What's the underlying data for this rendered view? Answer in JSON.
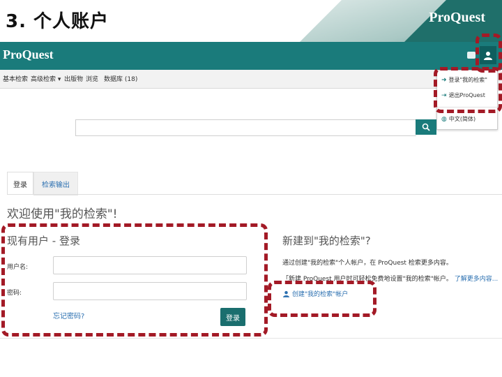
{
  "slide": {
    "title": "3. 个人账户",
    "deco_logo": "ProQuest"
  },
  "header": {
    "brand": "ProQuest",
    "icons": [
      "folder-icon",
      "user-icon"
    ]
  },
  "nav": {
    "items": [
      "基本检索",
      "高级检索 ▾",
      "出版物",
      "浏览",
      "数据库 (18)"
    ]
  },
  "account_menu": {
    "items": [
      {
        "icon": "login-icon",
        "label": "登录\"我的检索\""
      },
      {
        "icon": "logout-icon",
        "label": "退出ProQuest"
      },
      {
        "icon": "globe-icon",
        "label": "中文(简体)"
      }
    ]
  },
  "search": {
    "placeholder": "",
    "button_icon": "search-icon"
  },
  "tabs": [
    {
      "label": "登录",
      "active": true
    },
    {
      "label": "检索输出",
      "active": false
    }
  ],
  "welcome": "欢迎使用\"我的检索\"!",
  "login": {
    "heading": "现有用户 - 登录",
    "username_label": "用户名:",
    "password_label": "密码:",
    "forgot": "忘记密码?",
    "submit": "登录"
  },
  "register": {
    "heading": "新建到\"我的检索\"?",
    "desc": "通过创建\"我的检索\"个人帐户，在 ProQuest 检索更多内容。",
    "desc2_prefix": "「新建 ProQuest 用户时可轻松免费地设置\"我的检索\"帐户。",
    "desc2_link": "了解更多内容...",
    "create_link": "创建\"我的检索\"帐户"
  },
  "colors": {
    "teal": "#1a7b7b",
    "highlight": "#a31a26",
    "link": "#2a6fb0"
  }
}
